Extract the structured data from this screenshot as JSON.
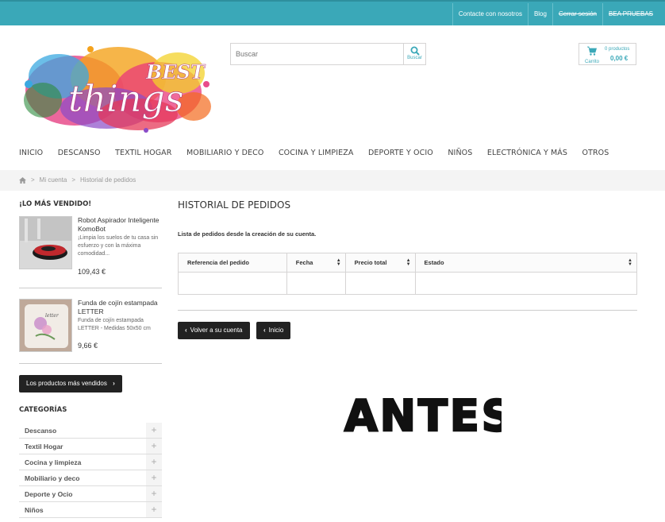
{
  "topbar": {
    "links": [
      "Contacte con nosotros",
      "Blog",
      "Cerrar sesión",
      "BEA PRUEBAS"
    ]
  },
  "logo": {
    "line1": "BEST",
    "line2": "things"
  },
  "search": {
    "placeholder": "Buscar",
    "button_label": "Buscar"
  },
  "cart": {
    "label": "Carrito",
    "count": "0 productos",
    "total": "0,00 €"
  },
  "nav": [
    "INICIO",
    "DESCANSO",
    "TEXTIL HOGAR",
    "MOBILIARIO Y DECO",
    "COCINA Y LIMPIEZA",
    "DEPORTE Y OCIO",
    "NIÑOS",
    "ELECTRÓNICA Y MÁS",
    "OTROS"
  ],
  "breadcrumb": {
    "home_icon": "home-icon",
    "items": [
      "Mi cuenta",
      "Historial de pedidos"
    ]
  },
  "sidebar": {
    "bestsellers_title": "¡LO MÁS VENDIDO!",
    "products": [
      {
        "name": "Robot Aspirador Inteligente KomoBot",
        "desc": "¡Limpia los suelos de tu casa sin esfuerzo y con la máxima comodidad...",
        "price": "109,43 €"
      },
      {
        "name": "Funda de cojín estampada LETTER",
        "desc": "Funda de cojín estampada LETTER - Medidas 50x50 cm",
        "price": "9,66 €"
      }
    ],
    "bestsellers_button": "Los productos más vendidos",
    "categories_title": "CATEGORÍAS",
    "categories": [
      "Descanso",
      "Textil Hogar",
      "Cocina y limpieza",
      "Mobiliario y deco",
      "Deporte y Ocio",
      "Niños"
    ]
  },
  "main": {
    "title": "HISTORIAL DE PEDIDOS",
    "info": "Lista de pedidos desde la creación de su cuenta.",
    "table_headers": [
      "Referencia del pedido",
      "Fecha",
      "Precio total",
      "Estado"
    ],
    "back_button": "Volver a su cuenta",
    "home_button": "Inicio"
  },
  "overlay_text": "ANTES",
  "colors": {
    "topbar": "#3aa8b8",
    "accent": "#3aa8b8",
    "dark_button": "#222222"
  }
}
